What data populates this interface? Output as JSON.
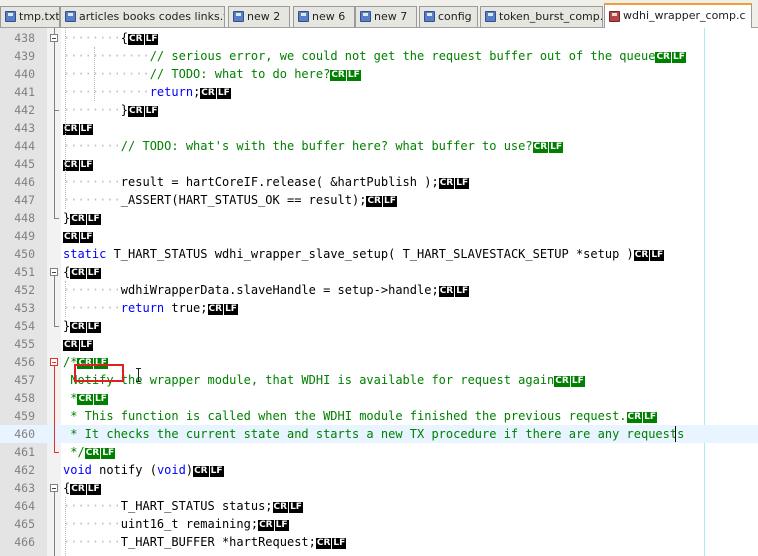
{
  "tabs": [
    {
      "label": "tmp.txt",
      "state": "saved"
    },
    {
      "label": "articles books codes links.txt",
      "state": "saved"
    },
    {
      "label": "new  2",
      "state": "saved"
    },
    {
      "label": "new  6",
      "state": "saved"
    },
    {
      "label": "new  7",
      "state": "saved"
    },
    {
      "label": "config",
      "state": "saved"
    },
    {
      "label": "token_burst_comp.c",
      "state": "saved"
    },
    {
      "label": "wdhi_wrapper_comp.c",
      "state": "unsaved",
      "active": true
    }
  ],
  "eol_marker": {
    "cr": "CR",
    "lf": "LF"
  },
  "colors": {
    "keyword": "#0000ff",
    "comment": "#008000",
    "eol_default": "#000000",
    "eol_in_comment": "#008000",
    "fold_marker_selected": "#e03030",
    "annotation_box": "#e02020"
  },
  "lines": [
    {
      "num": "438",
      "indent": 2,
      "segs": [
        [
          "p",
          "{"
        ]
      ],
      "eol": "black"
    },
    {
      "num": "439",
      "indent": 3,
      "segs": [
        [
          "c",
          "// serious error, we could not get the request buffer out of the queue"
        ]
      ],
      "eol": "green"
    },
    {
      "num": "440",
      "indent": 3,
      "segs": [
        [
          "c",
          "// TODO: what to do here?"
        ]
      ],
      "eol": "green"
    },
    {
      "num": "441",
      "indent": 3,
      "segs": [
        [
          "k",
          "return"
        ],
        [
          "p",
          ";"
        ]
      ],
      "eol": "black"
    },
    {
      "num": "442",
      "indent": 2,
      "segs": [
        [
          "p",
          "}"
        ]
      ],
      "eol": "black"
    },
    {
      "num": "443",
      "indent": 0,
      "segs": [],
      "eol": "black"
    },
    {
      "num": "444",
      "indent": 2,
      "segs": [
        [
          "c",
          "// TODO: what's with the buffer here? what buffer to use?"
        ]
      ],
      "eol": "green"
    },
    {
      "num": "445",
      "indent": 0,
      "segs": [],
      "eol": "black"
    },
    {
      "num": "446",
      "indent": 2,
      "segs": [
        [
          "p",
          "result = hartCoreIF.release( &hartPublish );"
        ]
      ],
      "eol": "black"
    },
    {
      "num": "447",
      "indent": 2,
      "segs": [
        [
          "p",
          "_ASSERT(HART_STATUS_OK == result);"
        ]
      ],
      "eol": "black"
    },
    {
      "num": "448",
      "indent": 0,
      "segs": [
        [
          "p",
          "}"
        ]
      ],
      "eol": "black"
    },
    {
      "num": "449",
      "indent": 0,
      "segs": [],
      "eol": "black"
    },
    {
      "num": "450",
      "indent": 0,
      "segs": [
        [
          "k",
          "static"
        ],
        [
          "p",
          " T_HART_STATUS wdhi_wrapper_slave_setup( T_HART_SLAVESTACK_SETUP *setup )"
        ]
      ],
      "eol": "black"
    },
    {
      "num": "451",
      "indent": 0,
      "segs": [
        [
          "p",
          "{"
        ]
      ],
      "eol": "black"
    },
    {
      "num": "452",
      "indent": 2,
      "segs": [
        [
          "p",
          "wdhiWrapperData.slaveHandle = setup->handle;"
        ]
      ],
      "eol": "black"
    },
    {
      "num": "453",
      "indent": 2,
      "segs": [
        [
          "k",
          "return"
        ],
        [
          "p",
          " true;"
        ]
      ],
      "eol": "black"
    },
    {
      "num": "454",
      "indent": 0,
      "segs": [
        [
          "p",
          "}"
        ]
      ],
      "eol": "black"
    },
    {
      "num": "455",
      "indent": 0,
      "segs": [],
      "eol": "black"
    },
    {
      "num": "456",
      "indent": 0,
      "segs": [
        [
          "c",
          "/*"
        ]
      ],
      "eol": "green"
    },
    {
      "num": "457",
      "indent": 0,
      "segs": [
        [
          "c",
          " Notify the wrapper module, that WDHI is available for request again"
        ]
      ],
      "eol": "green"
    },
    {
      "num": "458",
      "indent": 0,
      "segs": [
        [
          "c",
          " *"
        ]
      ],
      "eol": "green"
    },
    {
      "num": "459",
      "indent": 0,
      "segs": [
        [
          "c",
          " * This function is called when the WDHI module finished the previous request."
        ]
      ],
      "eol": "green"
    },
    {
      "num": "460",
      "indent": 0,
      "segs": [
        [
          "c",
          " * It checks the current state and starts a new TX procedure if there are any requests"
        ]
      ],
      "eol": "none",
      "current": true
    },
    {
      "num": "461",
      "indent": 0,
      "segs": [
        [
          "c",
          " */"
        ]
      ],
      "eol": "green"
    },
    {
      "num": "462",
      "indent": 0,
      "segs": [
        [
          "k",
          "void"
        ],
        [
          "p",
          " notify ("
        ],
        [
          "k",
          "void"
        ],
        [
          "p",
          ")"
        ]
      ],
      "eol": "black"
    },
    {
      "num": "463",
      "indent": 0,
      "segs": [
        [
          "p",
          "{"
        ]
      ],
      "eol": "black"
    },
    {
      "num": "464",
      "indent": 2,
      "segs": [
        [
          "p",
          "T_HART_STATUS status;"
        ]
      ],
      "eol": "black"
    },
    {
      "num": "465",
      "indent": 2,
      "segs": [
        [
          "p",
          "uint16_t remaining;"
        ]
      ],
      "eol": "black"
    },
    {
      "num": "466",
      "indent": 2,
      "segs": [
        [
          "p",
          "T_HART_BUFFER *hartRequest;"
        ]
      ],
      "eol": "black"
    }
  ]
}
